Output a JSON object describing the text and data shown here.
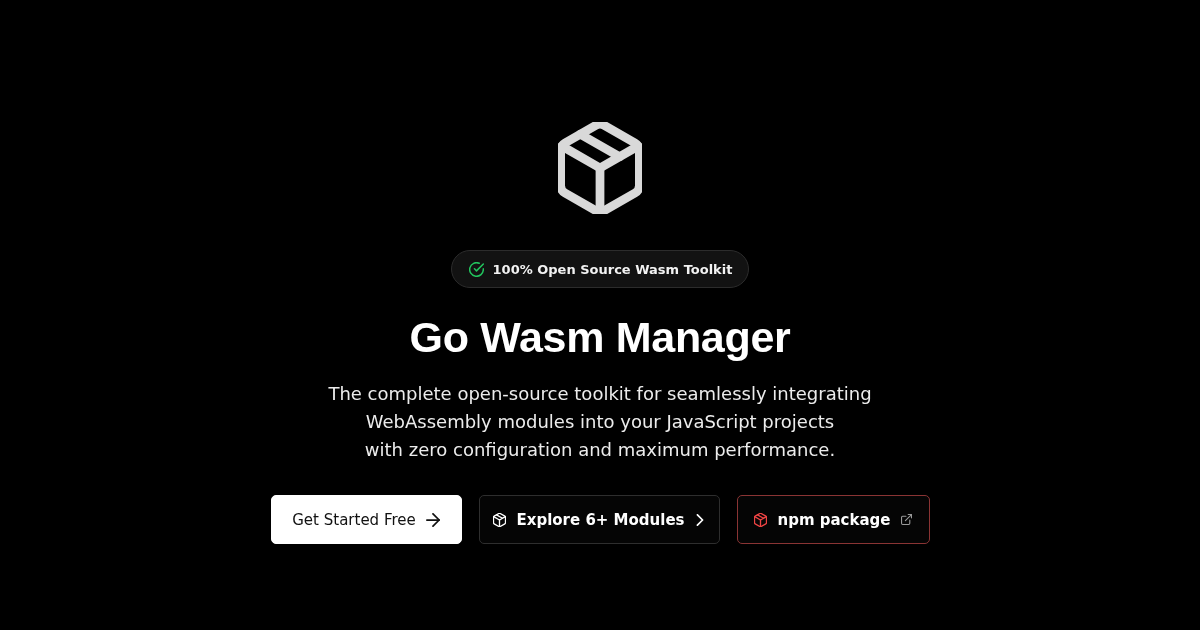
{
  "badge": {
    "text": "100% Open Source Wasm Toolkit"
  },
  "title": "Go Wasm Manager",
  "description": [
    "The complete open-source toolkit for seamlessly integrating",
    "WebAssembly modules into your JavaScript projects",
    "with zero configuration and maximum performance."
  ],
  "buttons": [
    {
      "kind": "primary",
      "label": "Get Started Free"
    },
    {
      "kind": "secondary",
      "label": "Explore 6+ Modules"
    },
    {
      "kind": "accent",
      "label": "npm package"
    }
  ]
}
